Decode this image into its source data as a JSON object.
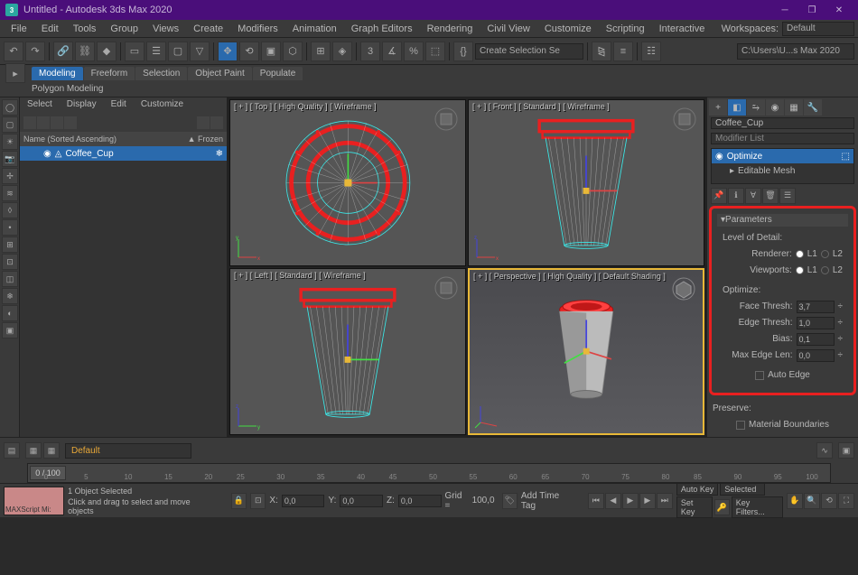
{
  "window": {
    "title": "Untitled - Autodesk 3ds Max 2020"
  },
  "menu": [
    "File",
    "Edit",
    "Tools",
    "Group",
    "Views",
    "Create",
    "Modifiers",
    "Animation",
    "Graph Editors",
    "Rendering",
    "Civil View",
    "Customize",
    "Scripting",
    "Interactive"
  ],
  "workspace": {
    "label": "Workspaces:",
    "value": "Default"
  },
  "toolbar_sel": "Create Selection Se",
  "path_dd": "C:\\Users\\U...s Max 2020",
  "ribbon_tabs": [
    "Modeling",
    "Freeform",
    "Selection",
    "Object Paint",
    "Populate"
  ],
  "ribbon_sub": "Polygon Modeling",
  "scene_explorer": {
    "tabs": [
      "Select",
      "Display",
      "Edit",
      "Customize"
    ],
    "header_name": "Name (Sorted Ascending)",
    "header_frozen": "▲ Frozen",
    "item": "Coffee_Cup"
  },
  "viewports": {
    "tl": "[ + ] [ Top ] [ High Quality ] [ Wireframe ]",
    "tr": "[ + ] [ Front ] [ Standard ] [ Wireframe ]",
    "bl": "[ + ] [ Left ] [ Standard ] [ Wireframe ]",
    "br": "[ + ] [ Perspective ] [ High Quality ] [ Default Shading ]"
  },
  "cmd_panel": {
    "obj_name": "Coffee_Cup",
    "mod_list": "Modifier List",
    "stack": [
      "Optimize",
      "Editable Mesh"
    ],
    "params": {
      "title": "Parameters",
      "lod_label": "Level of Detail:",
      "renderer": "Renderer:",
      "viewports": "Viewports:",
      "l1": "L1",
      "l2": "L2",
      "opt_label": "Optimize:",
      "face_thresh_l": "Face Thresh:",
      "face_thresh_v": "3,7",
      "edge_thresh_l": "Edge Thresh:",
      "edge_thresh_v": "1,0",
      "bias_l": "Bias:",
      "bias_v": "0,1",
      "max_edge_l": "Max Edge Len:",
      "max_edge_v": "0,0",
      "auto_edge": "Auto Edge",
      "preserve": "Preserve:",
      "mat_bound": "Material Boundaries"
    }
  },
  "track": {
    "default_layer": "Default",
    "slider": "0 / 100"
  },
  "timeline_ticks": [
    "0",
    "5",
    "10",
    "15",
    "20",
    "25",
    "30",
    "35",
    "40",
    "45",
    "50",
    "55",
    "60",
    "65",
    "70",
    "75",
    "80",
    "85",
    "90",
    "95",
    "100"
  ],
  "status": {
    "thumb": "MAXScript Mi:",
    "sel": "1 Object Selected",
    "prompt": "Click and drag to select and move objects",
    "x_l": "X:",
    "x_v": "0,0",
    "y_l": "Y:",
    "y_v": "0,0",
    "z_l": "Z:",
    "z_v": "0,0",
    "grid_l": "Grid =",
    "grid_v": "100,0",
    "addtime": "Add Time Tag",
    "autokey": "Auto Key",
    "selected": "Selected",
    "setkey": "Set Key",
    "keyfilters": "Key Filters..."
  }
}
